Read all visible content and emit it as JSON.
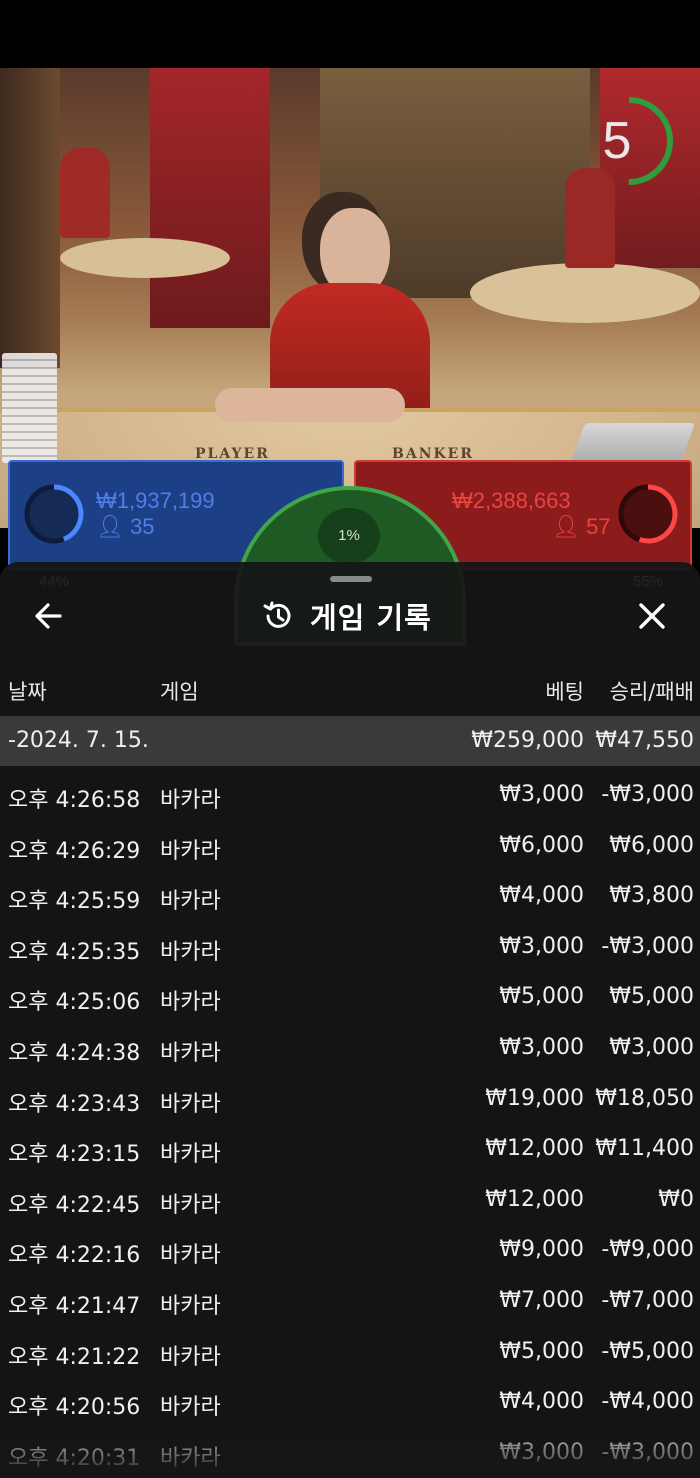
{
  "video": {
    "countdown": "5",
    "countdown_fraction": 0.5,
    "felt_player": "PLAYER",
    "felt_banker": "BANKER"
  },
  "betbar": {
    "player": {
      "percent": "44%",
      "percent_value": 0.44,
      "amount": "₩1,937,199",
      "players": "35"
    },
    "banker": {
      "percent": "55%",
      "percent_value": 0.55,
      "amount": "₩2,388,663",
      "players": "57"
    },
    "tie": {
      "percent": "1%"
    }
  },
  "sheet": {
    "title": "게임 기록",
    "columns": {
      "date": "날짜",
      "game": "게임",
      "bet": "베팅",
      "result": "승리/패배"
    },
    "date_group": {
      "label": "-2024. 7. 15.",
      "bet": "₩259,000",
      "result": "₩47,550"
    },
    "rows": [
      {
        "time": "오후 4:26:58",
        "game": "바카라",
        "bet": "₩3,000",
        "result": "-₩3,000"
      },
      {
        "time": "오후 4:26:29",
        "game": "바카라",
        "bet": "₩6,000",
        "result": "₩6,000"
      },
      {
        "time": "오후 4:25:59",
        "game": "바카라",
        "bet": "₩4,000",
        "result": "₩3,800"
      },
      {
        "time": "오후 4:25:35",
        "game": "바카라",
        "bet": "₩3,000",
        "result": "-₩3,000"
      },
      {
        "time": "오후 4:25:06",
        "game": "바카라",
        "bet": "₩5,000",
        "result": "₩5,000"
      },
      {
        "time": "오후 4:24:38",
        "game": "바카라",
        "bet": "₩3,000",
        "result": "₩3,000"
      },
      {
        "time": "오후 4:23:43",
        "game": "바카라",
        "bet": "₩19,000",
        "result": "₩18,050"
      },
      {
        "time": "오후 4:23:15",
        "game": "바카라",
        "bet": "₩12,000",
        "result": "₩11,400"
      },
      {
        "time": "오후 4:22:45",
        "game": "바카라",
        "bet": "₩12,000",
        "result": "₩0"
      },
      {
        "time": "오후 4:22:16",
        "game": "바카라",
        "bet": "₩9,000",
        "result": "-₩9,000"
      },
      {
        "time": "오후 4:21:47",
        "game": "바카라",
        "bet": "₩7,000",
        "result": "-₩7,000"
      },
      {
        "time": "오후 4:21:22",
        "game": "바카라",
        "bet": "₩5,000",
        "result": "-₩5,000"
      },
      {
        "time": "오후 4:20:56",
        "game": "바카라",
        "bet": "₩4,000",
        "result": "-₩4,000"
      },
      {
        "time": "오후 4:20:31",
        "game": "바카라",
        "bet": "₩3,000",
        "result": "-₩3,000"
      }
    ]
  },
  "colors": {
    "player_blue": "#1d3f86",
    "banker_red": "#8c1c1c",
    "tie_green": "#3fa64a",
    "date_row_bg": "#3a3a3a"
  }
}
